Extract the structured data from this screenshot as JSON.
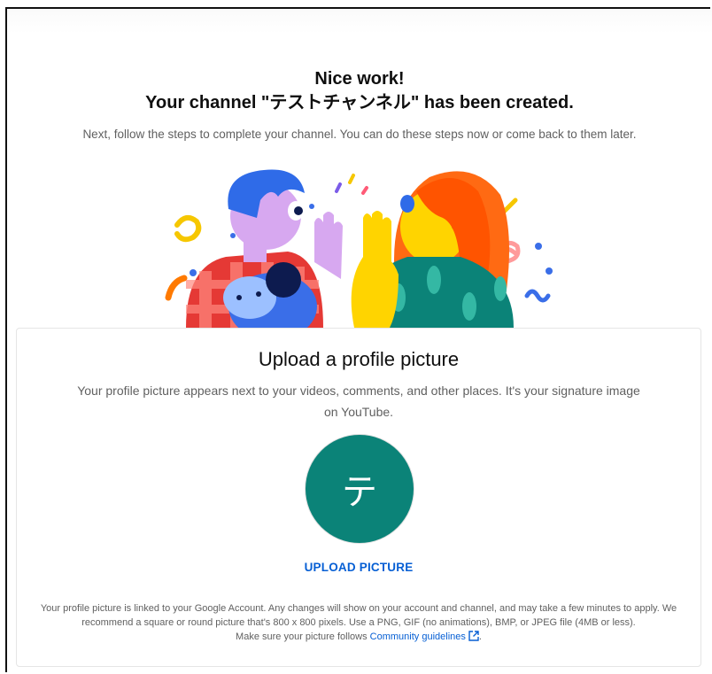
{
  "header": {
    "line1": "Nice work!",
    "line2": "Your channel \"テストチャンネル\" has been created."
  },
  "intro": "Next, follow the steps to complete your channel. You can do these steps now or come back to them later.",
  "card": {
    "title": "Upload a profile picture",
    "description": "Your profile picture appears next to your videos, comments, and other places. It's your signature image on YouTube.",
    "avatar_letter": "テ",
    "upload_button": "UPLOAD PICTURE",
    "fineprint_line1": "Your profile picture is linked to your Google Account. Any changes will show on your account and channel, and may take a few minutes to apply. We recommend a square or round picture that's 800 x 800 pixels. Use a PNG, GIF (no animations), BMP, or JPEG file (4MB or less).",
    "fineprint_prefix": "Make sure your picture follows ",
    "guidelines_link": "Community guidelines",
    "fineprint_suffix": "."
  },
  "colors": {
    "avatar_bg": "#0b8378",
    "link": "#065fd4"
  }
}
